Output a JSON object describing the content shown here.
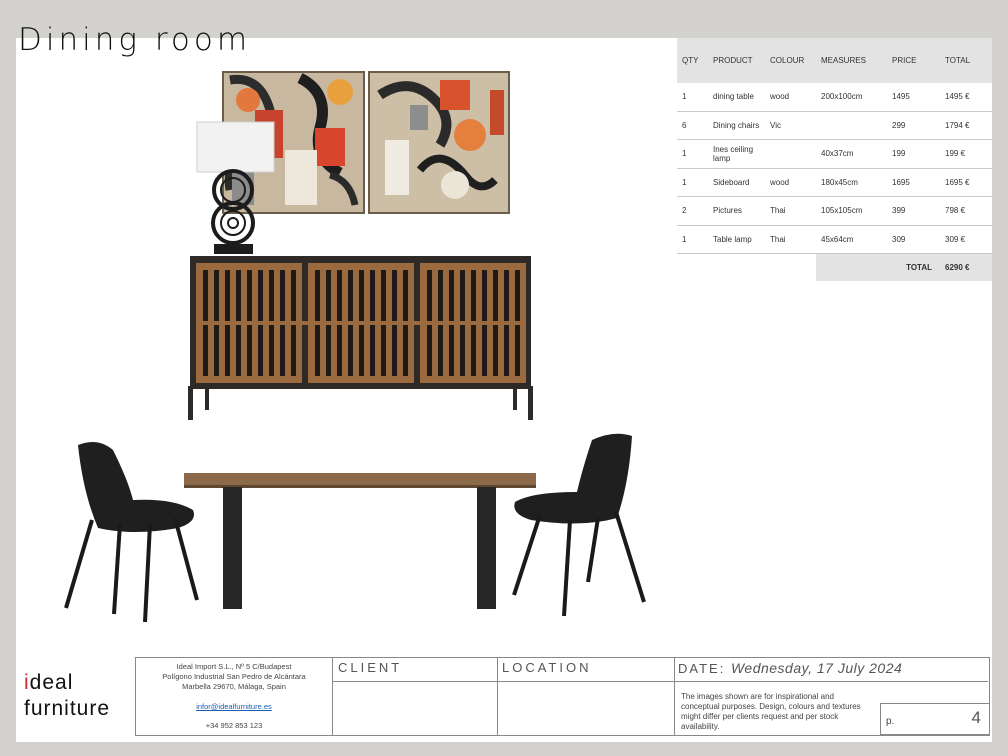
{
  "page": {
    "title": "Dining room"
  },
  "table": {
    "headers": [
      "QTY",
      "PRODUCT",
      "COLOUR",
      "MEASURES",
      "PRICE",
      "TOTAL"
    ],
    "rows": [
      [
        "1",
        "dining table",
        "wood",
        "200x100cm",
        "1495",
        "1495 €"
      ],
      [
        "6",
        "Dining chairs",
        "Vic",
        "",
        "299",
        "1794 €"
      ],
      [
        "1",
        "Ines ceiling lamp",
        "",
        "40x37cm",
        "199",
        "199 €"
      ],
      [
        "1",
        "Sideboard",
        "wood",
        "180x45cm",
        "1695",
        "1695 €"
      ],
      [
        "2",
        "Pictures",
        "Thai",
        "105x105cm",
        "399",
        "798 €"
      ],
      [
        "1",
        "Table lamp",
        "Thai",
        "45x64cm",
        "309",
        "309 €"
      ]
    ],
    "total_label": "TOTAL",
    "total_value": "6290 €"
  },
  "footer": {
    "logo_line1_dot": "i",
    "logo_line1_rest": "deal",
    "logo_line2": "furniture",
    "company_line1": "Ideal Import S.L., Nº 5 C/Budapest",
    "company_line2": "Polígono Industrial San Pedro de Alcántara",
    "company_line3": "Marbella 29670, Málaga, Spain",
    "email": "infor@idealfurniture.es",
    "phone": "+34 952 853 123",
    "client_label": "CLIENT",
    "location_label": "LOCATION",
    "date_label": "DATE:",
    "date_value": "Wednesday, 17 July 2024",
    "disclaimer": "The images shown are for inspirational and conceptual purposes. Design, colours and textures might differ per clients request and per stock availability.",
    "page_label": "p.",
    "page_number": "4"
  }
}
